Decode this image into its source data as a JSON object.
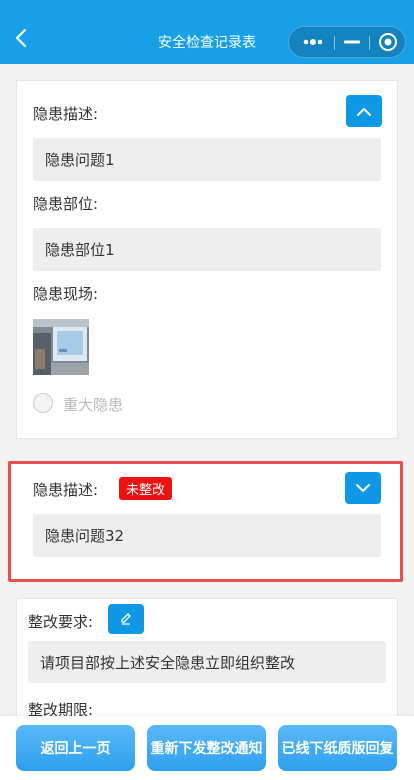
{
  "header": {
    "title": "安全检查记录表",
    "back_icon": "chevron-left-icon",
    "capsule": {
      "more_icon": "more-dots-icon",
      "minimize_icon": "minus-icon",
      "close_icon": "target-circle-icon"
    }
  },
  "hazard_card_1": {
    "desc_label": "隐患描述:",
    "desc_value": "隐患问题1",
    "position_label": "隐患部位:",
    "position_value": "隐患部位1",
    "scene_label": "隐患现场:",
    "major_label": "重大隐患",
    "toggle_icon": "chevron-up-icon"
  },
  "hazard_card_2": {
    "desc_label": "隐患描述:",
    "status_badge": "未整改",
    "desc_value": "隐患问题32",
    "toggle_icon": "chevron-down-icon"
  },
  "rectify_card": {
    "requirement_label": "整改要求:",
    "requirement_value": "请项目部按上述安全隐患立即组织整改",
    "deadline_label": "整改期限:",
    "edit_icon": "pencil-icon"
  },
  "bottom_bar": {
    "back_button": "返回上一页",
    "reissue_button": "重新下发整改通知",
    "offline_button": "已线下纸质版回复"
  },
  "colors": {
    "primary": "#17a0e8",
    "button": "#0f98e6",
    "alert_red": "#ee1111",
    "highlight_border": "#e5504f"
  }
}
